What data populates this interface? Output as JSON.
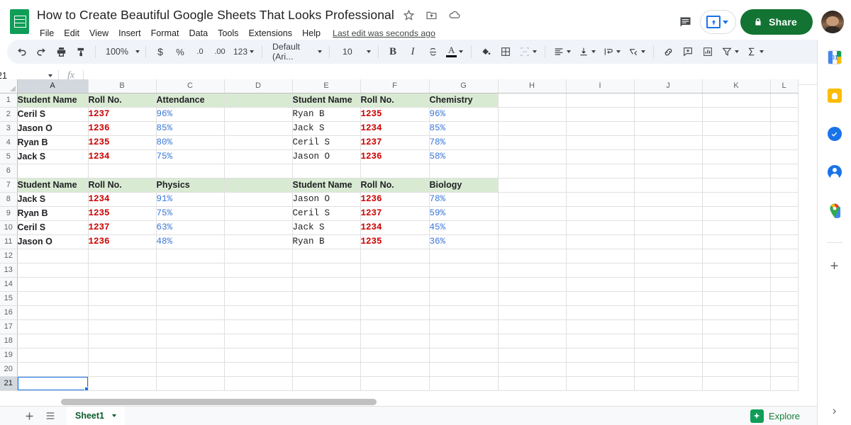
{
  "header": {
    "doc_title": "How to Create Beautiful Google Sheets That Looks Professional",
    "logo_icon": "sheets-logo-icon",
    "title_icons": [
      "star-icon",
      "move-to-folder-icon",
      "cloud-saved-icon"
    ],
    "menus": [
      "File",
      "Edit",
      "View",
      "Insert",
      "Format",
      "Data",
      "Tools",
      "Extensions",
      "Help"
    ],
    "last_edit": "Last edit was seconds ago",
    "comment_icon": "comment-history-icon",
    "present_label": "present-button",
    "share_label": "Share",
    "share_icon": "lock-icon",
    "avatar": "user-avatar"
  },
  "toolbar": {
    "undo": "undo-icon",
    "redo": "redo-icon",
    "print": "print-icon",
    "paint": "paint-format-icon",
    "zoom_value": "100%",
    "currency": "$",
    "percent": "%",
    "decimal_decrease": ".0",
    "decimal_increase": ".00",
    "number_format": "123",
    "font_name": "Default (Ari...",
    "font_size": "10",
    "bold": "B",
    "italic": "I",
    "strikethrough": "S",
    "text_color": "A",
    "text_color_swatch": "#000000",
    "fill_color": "fill-color-icon",
    "borders": "borders-icon",
    "merge": "merge-cells-icon",
    "align": "horizontal-align-icon",
    "valign": "vertical-align-icon",
    "wrap": "text-wrap-icon",
    "rotate": "text-rotation-icon",
    "link": "insert-link-icon",
    "comment": "insert-comment-icon",
    "chart": "insert-chart-icon",
    "filter": "filter-icon",
    "functions": "functions-sigma-icon",
    "collapse": "collapse-toolbar-icon"
  },
  "formula_bar": {
    "name_box": "21",
    "fx": "fx",
    "formula_value": ""
  },
  "grid": {
    "columns": [
      "A",
      "B",
      "C",
      "D",
      "E",
      "F",
      "G",
      "H",
      "I",
      "J",
      "K",
      "L"
    ],
    "selected_column": "A",
    "selected_row": 21,
    "selected_cell": "A21",
    "rows": [
      1,
      2,
      3,
      4,
      5,
      6,
      7,
      8,
      9,
      10,
      11,
      12,
      13,
      14,
      15,
      16,
      17,
      18,
      19,
      20,
      21
    ],
    "cells": {
      "1": {
        "A": "Student Name",
        "B": "Roll No.",
        "C": "Attendance",
        "D": "",
        "E": "Student Name",
        "F": "Roll No.",
        "G": "Chemistry"
      },
      "2": {
        "A": "Ceril S",
        "B": "1237",
        "C": "96%",
        "D": "",
        "E": "Ryan B",
        "F": "1235",
        "G": "96%"
      },
      "3": {
        "A": "Jason O",
        "B": "1236",
        "C": "85%",
        "D": "",
        "E": "Jack S",
        "F": "1234",
        "G": "85%"
      },
      "4": {
        "A": "Ryan B",
        "B": "1235",
        "C": "80%",
        "D": "",
        "E": "Ceril S",
        "F": "1237",
        "G": "78%"
      },
      "5": {
        "A": "Jack S",
        "B": "1234",
        "C": "75%",
        "D": "",
        "E": "Jason O",
        "F": "1236",
        "G": "58%"
      },
      "6": {
        "A": "",
        "B": "",
        "C": "",
        "D": "",
        "E": "",
        "F": "",
        "G": ""
      },
      "7": {
        "A": "Student Name",
        "B": "Roll No.",
        "C": "Physics",
        "D": "",
        "E": "Student Name",
        "F": "Roll No.",
        "G": "Biology"
      },
      "8": {
        "A": "Jack S",
        "B": "1234",
        "C": "91%",
        "D": "",
        "E": "Jason O",
        "F": "1236",
        "G": "78%"
      },
      "9": {
        "A": "Ryan B",
        "B": "1235",
        "C": "75%",
        "D": "",
        "E": "Ceril S",
        "F": "1237",
        "G": "59%"
      },
      "10": {
        "A": "Ceril S",
        "B": "1237",
        "C": "63%",
        "D": "",
        "E": "Jack S",
        "F": "1234",
        "G": "45%"
      },
      "11": {
        "A": "Jason O",
        "B": "1236",
        "C": "48%",
        "D": "",
        "E": "Ryan B",
        "F": "1235",
        "G": "36%"
      }
    },
    "colors": {
      "header_fill": "#d9ead3",
      "roll_text": "#cc0000",
      "percent_text": "#3c78d8",
      "selection": "#1a73e8"
    }
  },
  "bottom": {
    "add_sheet": "add-sheet-icon",
    "all_sheets": "all-sheets-icon",
    "sheet_name": "Sheet1",
    "explore_label": "Explore"
  },
  "side_panel": {
    "icons": [
      "google-calendar-icon",
      "google-keep-icon",
      "google-tasks-icon",
      "google-contacts-icon",
      "google-maps-icon"
    ],
    "calendar_day": "31",
    "add_label": "+",
    "expand_label": "›"
  }
}
